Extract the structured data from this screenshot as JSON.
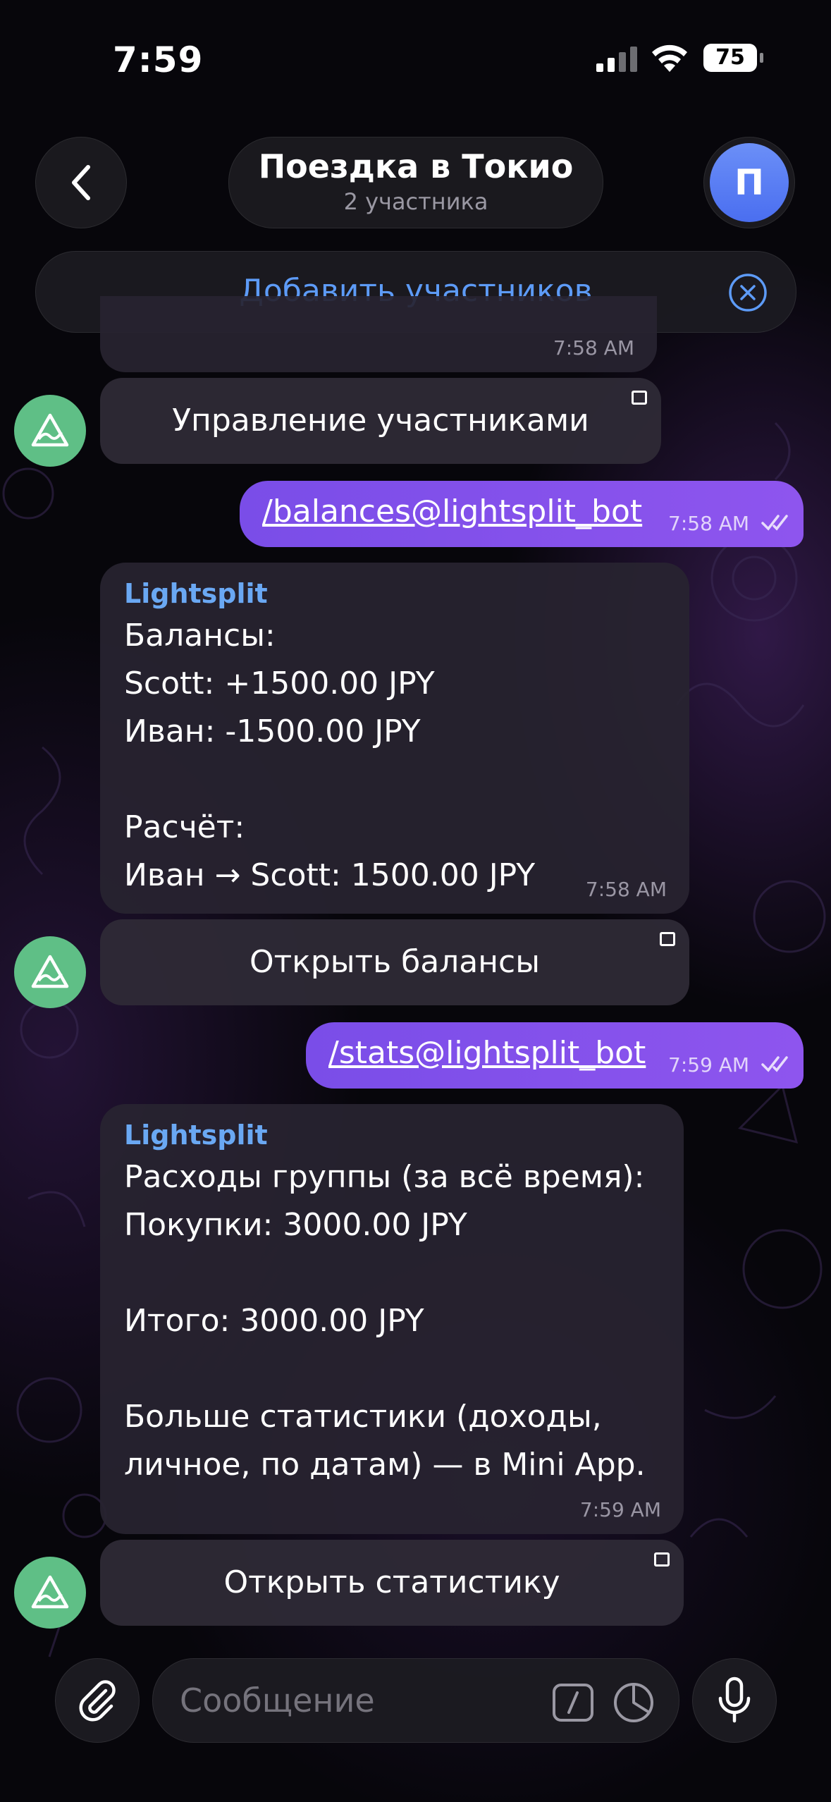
{
  "status_bar": {
    "time": "7:59",
    "battery": "75"
  },
  "header": {
    "title": "Поездка в Токио",
    "subtitle": "2 участника",
    "avatar_letter": "П",
    "add_members_label": "Добавить участников"
  },
  "messages": {
    "partial_time": "7:58 AM",
    "manage_button": "Управление участниками",
    "balances_cmd": {
      "text": "/balances@lightsplit_bot",
      "time": "7:58 AM"
    },
    "balances_reply": {
      "sender": "Lightsplit",
      "text": "Балансы:\nScott: +1500.00 JPY\nИван: -1500.00 JPY\n\nРасчёт:\nИван → Scott: 1500.00 JPY",
      "time": "7:58 AM",
      "button": "Открыть балансы"
    },
    "stats_cmd": {
      "text": "/stats@lightsplit_bot",
      "time": "7:59 AM"
    },
    "stats_reply": {
      "sender": "Lightsplit",
      "text": "Расходы группы (за всё время):\nПокупки: 3000.00 JPY\n\nИтого: 3000.00 JPY\n\nБольше статистики (доходы,\nличное, по датам) — в Mini App.",
      "time": "7:59 AM",
      "button": "Открыть статистику"
    }
  },
  "composer": {
    "placeholder": "Сообщение"
  },
  "colors": {
    "accent_blue": "#5d9bf7",
    "outgoing": "#8150ea",
    "bot_avatar": "#5fbf86"
  }
}
